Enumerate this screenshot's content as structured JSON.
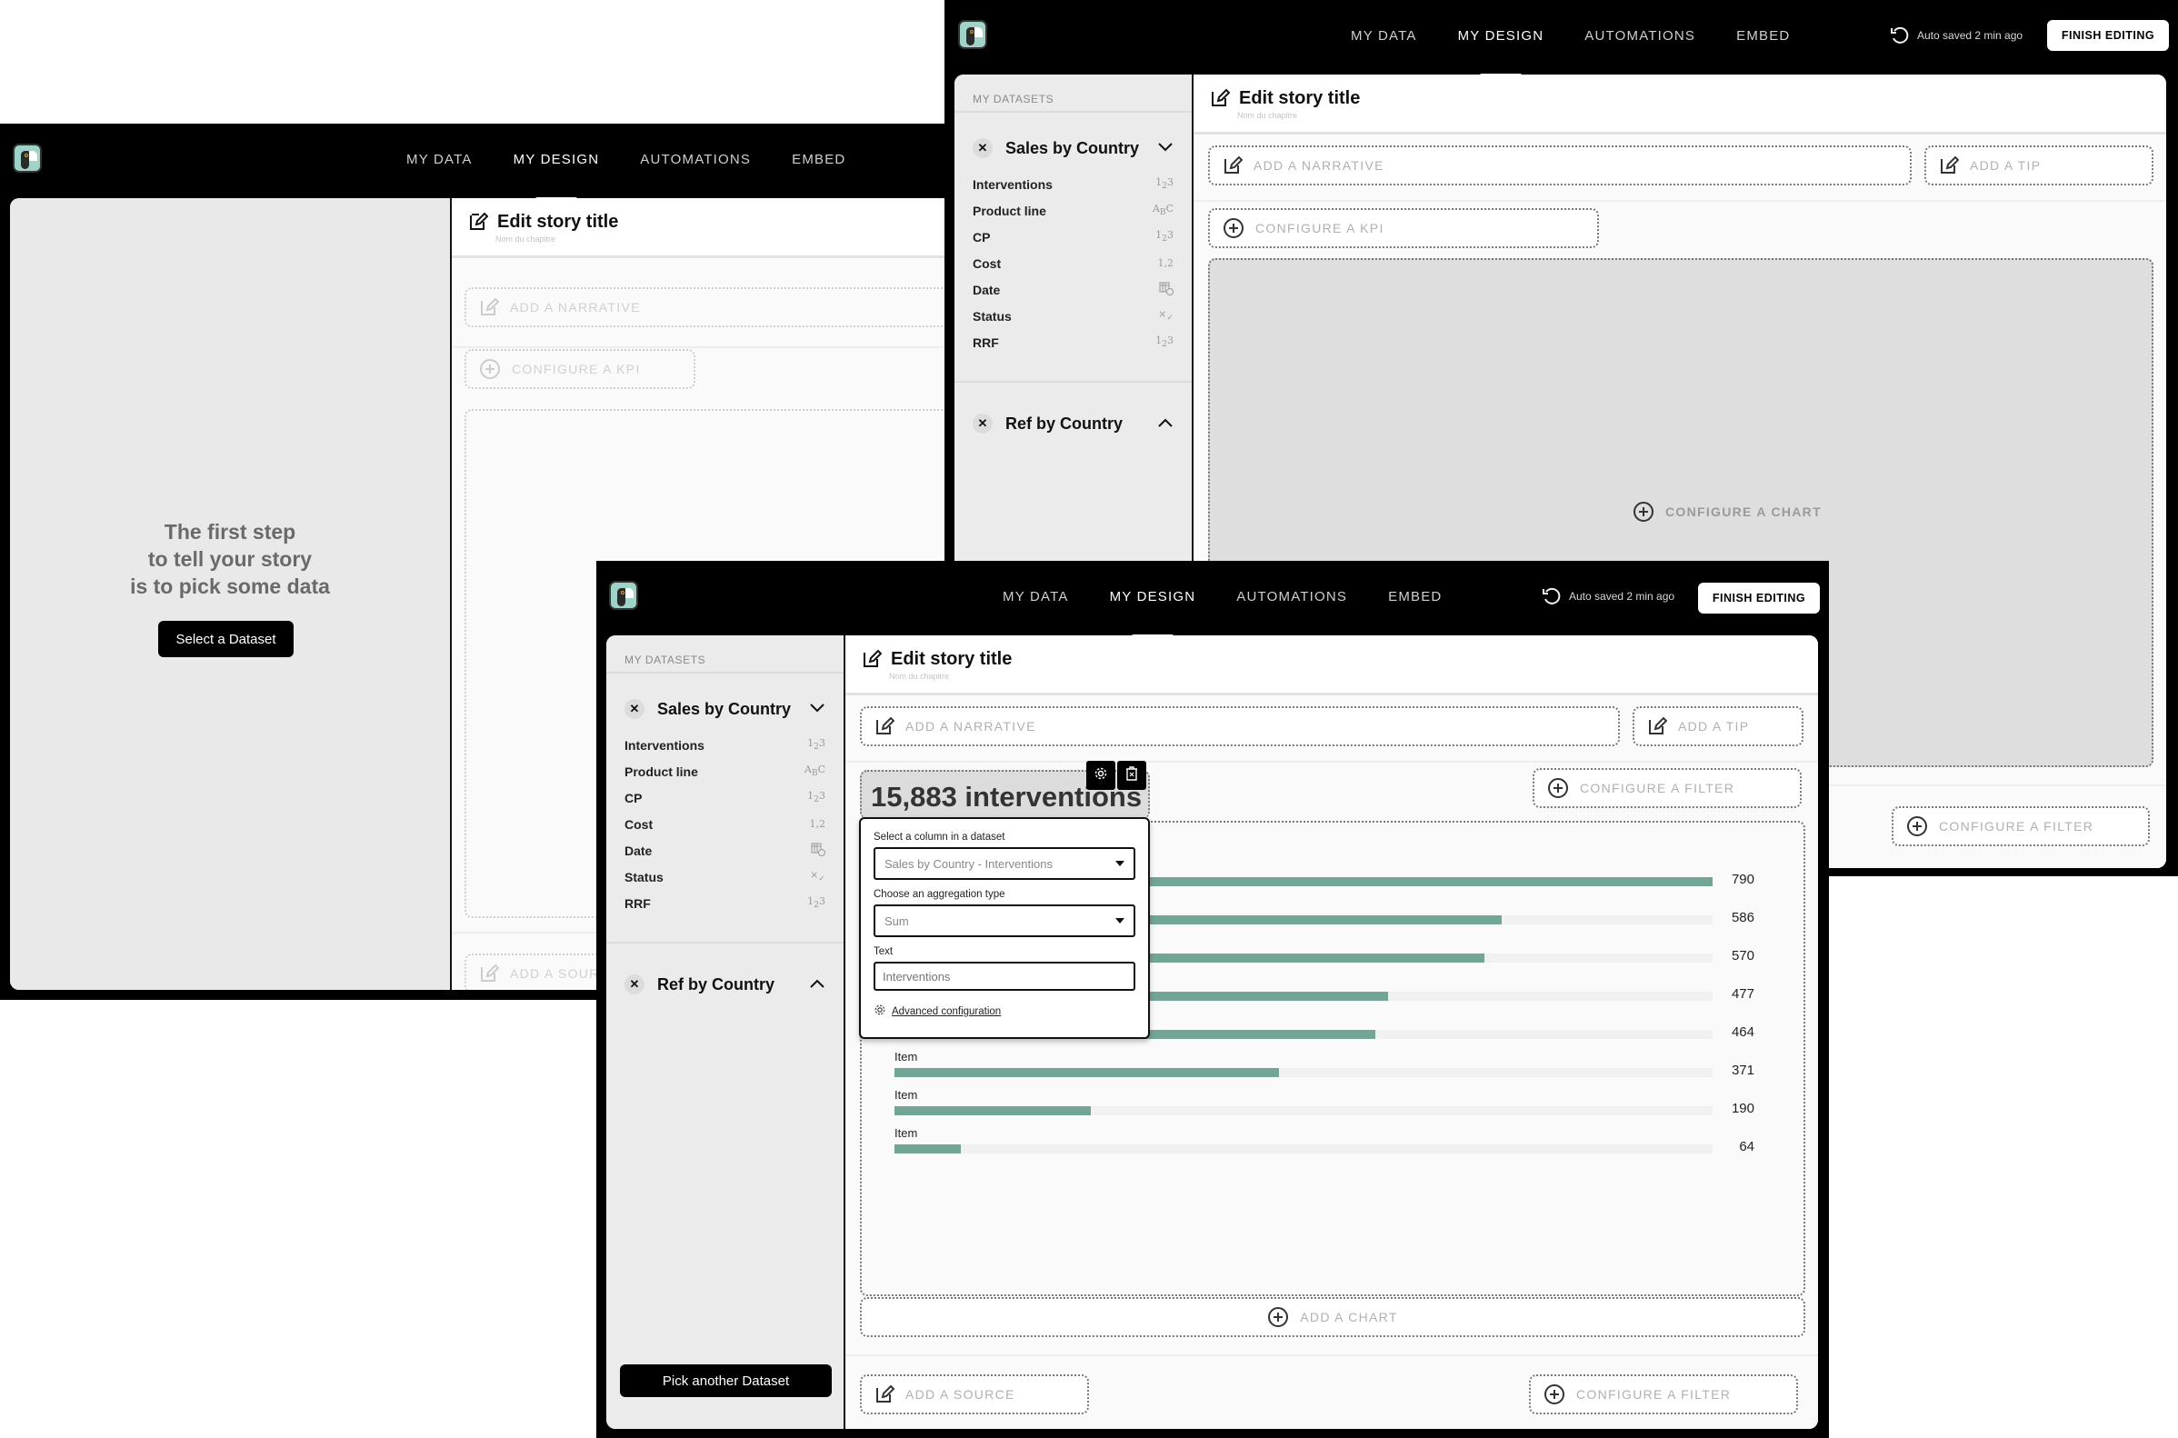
{
  "nav": {
    "items": [
      "MY DATA",
      "MY DESIGN",
      "AUTOMATIONS",
      "EMBED"
    ],
    "active": "MY DESIGN"
  },
  "autosave_text": "Auto saved 2 min ago",
  "finish_label": "FINISH EDITING",
  "story": {
    "title": "Edit story title",
    "subtitle": "Nom du chapitre"
  },
  "placeholders": {
    "narrative": "ADD A NARRATIVE",
    "tip": "ADD A TIP",
    "kpi": "CONFIGURE A KPI",
    "chart": "CONFIGURE A CHART",
    "filter": "CONFIGURE A FILTER",
    "add_chart": "ADD A CHART",
    "source": "ADD A SOURCE"
  },
  "empty_state": {
    "line1": "The first step",
    "line2": "to tell your story",
    "line3": "is to pick some data",
    "button": "Select a Dataset"
  },
  "sidebar": {
    "caption": "MY DATASETS",
    "datasets": [
      {
        "name": "Sales by Country",
        "expanded": true,
        "columns": [
          {
            "name": "Interventions",
            "type": "1₂3"
          },
          {
            "name": "Product line",
            "type": "ABC"
          },
          {
            "name": "CP",
            "type": "1₂3"
          },
          {
            "name": "Cost",
            "type": "1,2"
          },
          {
            "name": "Date",
            "type": "calendar-clock"
          },
          {
            "name": "Status",
            "type": "x✓"
          },
          {
            "name": "RRF",
            "type": "1₂3"
          }
        ]
      },
      {
        "name": "Ref by Country",
        "expanded": false
      }
    ],
    "pick_another": "Pick another Dataset"
  },
  "kpi": {
    "value_text": "15,883 interventions",
    "config": {
      "column_label": "Select a column in a dataset",
      "column_value": "Sales by Country - Interventions",
      "aggregation_label": "Choose an aggregation type",
      "aggregation_value": "Sum",
      "text_label": "Text",
      "text_placeholder": "Interventions",
      "advanced_link": "Advanced configuration"
    }
  },
  "chart_data": {
    "type": "bar",
    "orientation": "horizontal",
    "categories": [
      "Item",
      "Item",
      "Item",
      "Item",
      "Item",
      "Item",
      "Item",
      "Item"
    ],
    "values": [
      790,
      586,
      570,
      477,
      464,
      371,
      190,
      64
    ],
    "max": 790,
    "bar_color": "#73a597",
    "title": "",
    "xlabel": "",
    "ylabel": ""
  },
  "colors": {
    "bar": "#73a597",
    "logo_bg": "#9fd3c7",
    "header_bg": "#000000"
  }
}
